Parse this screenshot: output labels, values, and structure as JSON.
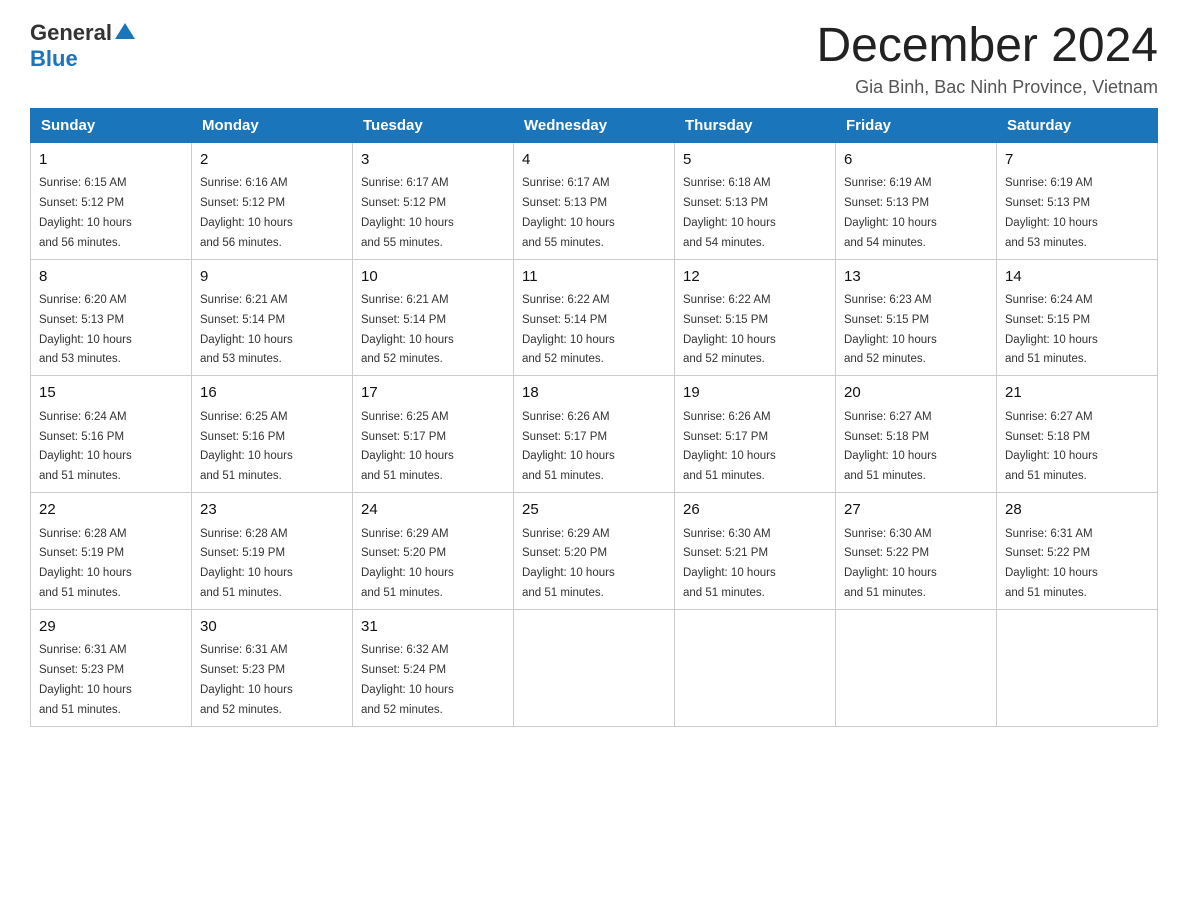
{
  "logo": {
    "general": "General",
    "blue": "Blue"
  },
  "header": {
    "month_year": "December 2024",
    "location": "Gia Binh, Bac Ninh Province, Vietnam"
  },
  "weekdays": [
    "Sunday",
    "Monday",
    "Tuesday",
    "Wednesday",
    "Thursday",
    "Friday",
    "Saturday"
  ],
  "weeks": [
    [
      {
        "day": "1",
        "sunrise": "6:15 AM",
        "sunset": "5:12 PM",
        "daylight": "10 hours and 56 minutes."
      },
      {
        "day": "2",
        "sunrise": "6:16 AM",
        "sunset": "5:12 PM",
        "daylight": "10 hours and 56 minutes."
      },
      {
        "day": "3",
        "sunrise": "6:17 AM",
        "sunset": "5:12 PM",
        "daylight": "10 hours and 55 minutes."
      },
      {
        "day": "4",
        "sunrise": "6:17 AM",
        "sunset": "5:13 PM",
        "daylight": "10 hours and 55 minutes."
      },
      {
        "day": "5",
        "sunrise": "6:18 AM",
        "sunset": "5:13 PM",
        "daylight": "10 hours and 54 minutes."
      },
      {
        "day": "6",
        "sunrise": "6:19 AM",
        "sunset": "5:13 PM",
        "daylight": "10 hours and 54 minutes."
      },
      {
        "day": "7",
        "sunrise": "6:19 AM",
        "sunset": "5:13 PM",
        "daylight": "10 hours and 53 minutes."
      }
    ],
    [
      {
        "day": "8",
        "sunrise": "6:20 AM",
        "sunset": "5:13 PM",
        "daylight": "10 hours and 53 minutes."
      },
      {
        "day": "9",
        "sunrise": "6:21 AM",
        "sunset": "5:14 PM",
        "daylight": "10 hours and 53 minutes."
      },
      {
        "day": "10",
        "sunrise": "6:21 AM",
        "sunset": "5:14 PM",
        "daylight": "10 hours and 52 minutes."
      },
      {
        "day": "11",
        "sunrise": "6:22 AM",
        "sunset": "5:14 PM",
        "daylight": "10 hours and 52 minutes."
      },
      {
        "day": "12",
        "sunrise": "6:22 AM",
        "sunset": "5:15 PM",
        "daylight": "10 hours and 52 minutes."
      },
      {
        "day": "13",
        "sunrise": "6:23 AM",
        "sunset": "5:15 PM",
        "daylight": "10 hours and 52 minutes."
      },
      {
        "day": "14",
        "sunrise": "6:24 AM",
        "sunset": "5:15 PM",
        "daylight": "10 hours and 51 minutes."
      }
    ],
    [
      {
        "day": "15",
        "sunrise": "6:24 AM",
        "sunset": "5:16 PM",
        "daylight": "10 hours and 51 minutes."
      },
      {
        "day": "16",
        "sunrise": "6:25 AM",
        "sunset": "5:16 PM",
        "daylight": "10 hours and 51 minutes."
      },
      {
        "day": "17",
        "sunrise": "6:25 AM",
        "sunset": "5:17 PM",
        "daylight": "10 hours and 51 minutes."
      },
      {
        "day": "18",
        "sunrise": "6:26 AM",
        "sunset": "5:17 PM",
        "daylight": "10 hours and 51 minutes."
      },
      {
        "day": "19",
        "sunrise": "6:26 AM",
        "sunset": "5:17 PM",
        "daylight": "10 hours and 51 minutes."
      },
      {
        "day": "20",
        "sunrise": "6:27 AM",
        "sunset": "5:18 PM",
        "daylight": "10 hours and 51 minutes."
      },
      {
        "day": "21",
        "sunrise": "6:27 AM",
        "sunset": "5:18 PM",
        "daylight": "10 hours and 51 minutes."
      }
    ],
    [
      {
        "day": "22",
        "sunrise": "6:28 AM",
        "sunset": "5:19 PM",
        "daylight": "10 hours and 51 minutes."
      },
      {
        "day": "23",
        "sunrise": "6:28 AM",
        "sunset": "5:19 PM",
        "daylight": "10 hours and 51 minutes."
      },
      {
        "day": "24",
        "sunrise": "6:29 AM",
        "sunset": "5:20 PM",
        "daylight": "10 hours and 51 minutes."
      },
      {
        "day": "25",
        "sunrise": "6:29 AM",
        "sunset": "5:20 PM",
        "daylight": "10 hours and 51 minutes."
      },
      {
        "day": "26",
        "sunrise": "6:30 AM",
        "sunset": "5:21 PM",
        "daylight": "10 hours and 51 minutes."
      },
      {
        "day": "27",
        "sunrise": "6:30 AM",
        "sunset": "5:22 PM",
        "daylight": "10 hours and 51 minutes."
      },
      {
        "day": "28",
        "sunrise": "6:31 AM",
        "sunset": "5:22 PM",
        "daylight": "10 hours and 51 minutes."
      }
    ],
    [
      {
        "day": "29",
        "sunrise": "6:31 AM",
        "sunset": "5:23 PM",
        "daylight": "10 hours and 51 minutes."
      },
      {
        "day": "30",
        "sunrise": "6:31 AM",
        "sunset": "5:23 PM",
        "daylight": "10 hours and 52 minutes."
      },
      {
        "day": "31",
        "sunrise": "6:32 AM",
        "sunset": "5:24 PM",
        "daylight": "10 hours and 52 minutes."
      },
      null,
      null,
      null,
      null
    ]
  ],
  "labels": {
    "sunrise": "Sunrise:",
    "sunset": "Sunset:",
    "daylight": "Daylight:"
  }
}
